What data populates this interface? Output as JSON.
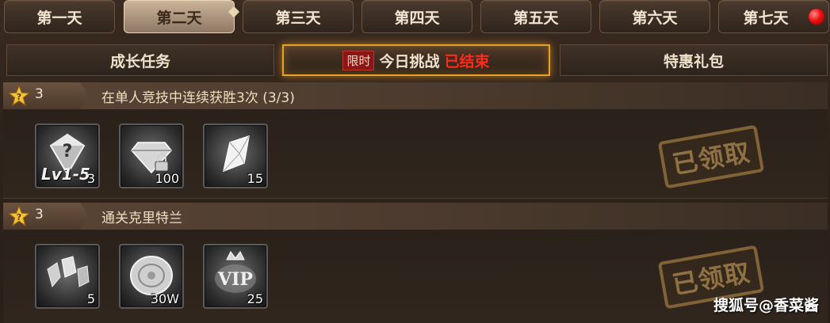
{
  "days": [
    {
      "label": "第一天",
      "active": false
    },
    {
      "label": "第二天",
      "active": true
    },
    {
      "label": "第三天",
      "active": false
    },
    {
      "label": "第四天",
      "active": false
    },
    {
      "label": "第五天",
      "active": false
    },
    {
      "label": "第六天",
      "active": false
    },
    {
      "label": "第七天",
      "active": false,
      "notification": true
    }
  ],
  "subtabs": {
    "growth": "成长任务",
    "limited_tag": "限时",
    "challenge": "今日挑战",
    "ended": "已结束",
    "gift": "特惠礼包"
  },
  "tasks": [
    {
      "stars": "3",
      "title": "在单人竞技中连续获胜3次 (3/3)",
      "status": "已领取",
      "items": [
        {
          "icon": "mystery-gem-icon",
          "level": "Lv1-5",
          "qty": "3"
        },
        {
          "icon": "locked-diamond-icon",
          "qty": "100"
        },
        {
          "icon": "crystal-shard-icon",
          "qty": "15"
        }
      ]
    },
    {
      "stars": "3",
      "title": "通关克里特兰",
      "status": "已领取",
      "items": [
        {
          "icon": "rune-stones-icon",
          "qty": "5"
        },
        {
          "icon": "silver-coin-icon",
          "qty": "30W"
        },
        {
          "icon": "vip-crown-icon",
          "qty": "25"
        }
      ]
    }
  ],
  "watermark": "搜狐号@香菜酱",
  "colors": {
    "accent": "#e6a327",
    "ended": "#ff2a1a",
    "tag_bg": "#8d1515"
  }
}
